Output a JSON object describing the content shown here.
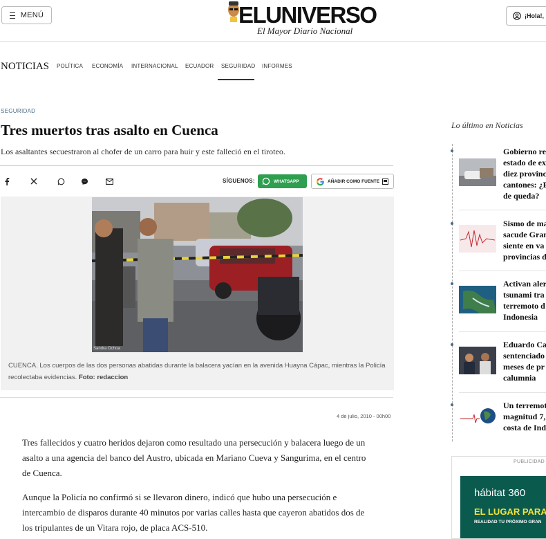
{
  "header": {
    "menu_label": "MENÚ",
    "logo_text": "ELUNIVERSO",
    "logo_tagline": "El Mayor Diario Nacional",
    "login_label": "¡Hola!,"
  },
  "nav": {
    "title": "NOTICIAS",
    "items": [
      {
        "label": "POLÍTICA"
      },
      {
        "label": "ECONOMÍA"
      },
      {
        "label": "INTERNACIONAL"
      },
      {
        "label": "ECUADOR"
      },
      {
        "label": "SEGURIDAD",
        "active": true
      },
      {
        "label": "INFORMES"
      }
    ]
  },
  "article": {
    "section": "SEGURIDAD",
    "headline": "Tres muertos tras asalto en Cuenca",
    "dek": "Los asaltantes secuestraron al chofer de un carro para huir y este falleció en el tiroteo.",
    "share_icons": [
      "facebook-icon",
      "x-icon",
      "whatsapp-icon",
      "messenger-icon",
      "email-icon"
    ],
    "siguenos_label": "SÍGUENOS:",
    "whatsapp_label": "WHATSAPP",
    "google_label": "AÑADIR COMO FUENTE",
    "caption": "CUENCA. Los cuerpos de las dos personas abatidas durante la balacera yacían en la avenida Huayna Cápac, mientras la Policía recolectaba evidencias.",
    "caption_credit": "Foto: redaccion",
    "photo_watermark": "Sandra Ochoa",
    "date": "4 de julio, 2010 - 00h00",
    "paragraphs": [
      "Tres fallecidos y cuatro heridos dejaron como resultado una persecución y balacera luego de un asalto a una agencia del banco del Austro, ubicada en Mariano Cueva y Sangurima, en el centro de Cuenca.",
      "Aunque la Policía no confirmó si se llevaron dinero, indicó que hubo una persecución e intercambio de disparos durante 40 minutos por varias calles hasta que cayeron abatidos dos de los tripulantes de un Vitara rojo, de placa ACS-510."
    ]
  },
  "sidebar": {
    "title": "Lo último en Noticias",
    "items": [
      {
        "title": "Gobierno re estado de ex diez provinc cantones: ¿E de queda?"
      },
      {
        "title": "Sismo de ma sacude Gran siente en va provincias d"
      },
      {
        "title": "Activan aler tsunami tra terremoto d Indonesia"
      },
      {
        "title": "Eduardo Car sentenciado meses de pr calumnia"
      },
      {
        "title": "Un terremot magnitud 7, costa de Ind"
      }
    ],
    "ad_label": "PUBLICIDAD",
    "ad_brand": "hábitat 360",
    "ad_headline": "EL LUGAR PARA H",
    "ad_sub": "REALIDAD TU PRÓXIMO GRAN"
  },
  "colors": {
    "section_blue": "#4a6a86",
    "whatsapp_green": "#2e9e4f",
    "ad_green": "#0a5a4e"
  }
}
